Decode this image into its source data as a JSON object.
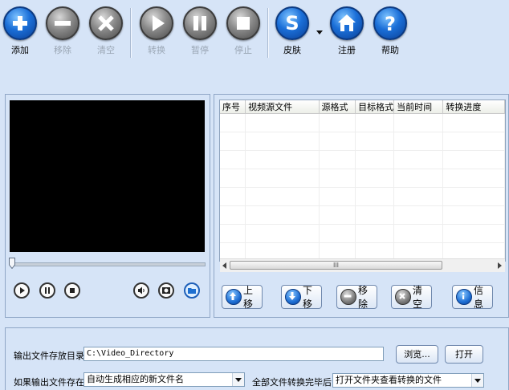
{
  "toolbar": {
    "add": "添加",
    "remove": "移除",
    "clear": "清空",
    "convert": "转换",
    "pause": "暂停",
    "stop": "停止",
    "skin": "皮肤",
    "register": "注册",
    "help": "帮助"
  },
  "file_table": {
    "columns": [
      "序号",
      "视频源文件",
      "源格式",
      "目标格式",
      "当前时间",
      "转换进度"
    ],
    "scrollbar_grip": "III"
  },
  "actions": {
    "move_up": "上移",
    "move_down": "下移",
    "remove": "移除",
    "clear": "清空",
    "info": "信息"
  },
  "output": {
    "dir_label": "输出文件存放目录:",
    "dir_value": "C:\\Video_Directory",
    "browse": "浏览...",
    "open": "打开",
    "exists_label": "如果输出文件存在:",
    "exists_value": "自动生成相应的新文件名",
    "done_label": "全部文件转换完毕后:",
    "done_value": "打开文件夹查看转换的文件"
  },
  "colors": {
    "background": "#d6e4f7",
    "accent_blue": "#1b6fd8",
    "disabled_gray": "#8a8a8a"
  }
}
